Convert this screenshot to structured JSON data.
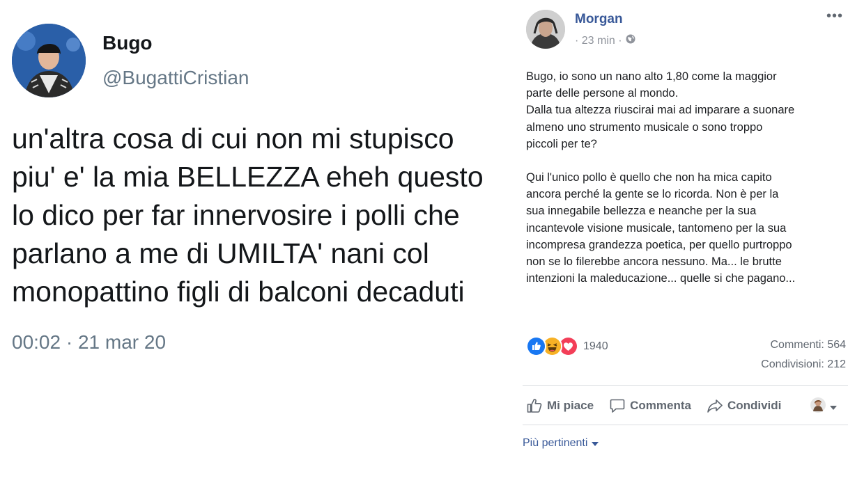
{
  "tweet": {
    "name": "Bugo",
    "handle": "@BugattiCristian",
    "text_lines": [
      "un'altra cosa di cui non mi stupisco",
      "piu' e' la mia BELLEZZA eheh questo",
      "lo dico per far innervosire i polli che",
      "parlano a me di UMILTA' nani col",
      "monopattino figli di balconi decaduti"
    ],
    "timestamp": "00:02 · 21 mar 20"
  },
  "fb_post": {
    "author": "Morgan",
    "time": "· 23 min ·",
    "privacy_icon": "globe-icon",
    "more_label": "•••",
    "paragraph1": [
      "Bugo, io sono un nano alto 1,80 come la maggior",
      "parte delle persone al mondo.",
      "Dalla tua altezza riuscirai mai ad imparare a suonare",
      "almeno uno strumento musicale o sono troppo",
      "piccoli per te?"
    ],
    "paragraph2": [
      "Qui l'unico pollo è quello che non ha mica capito",
      "ancora perché la gente se lo ricorda. Non è per la",
      "sua innegabile bellezza e neanche per la sua",
      "incantevole visione musicale, tantomeno per la sua",
      "incompresa grandezza poetica, per quello purtroppo",
      "non se lo filerebbe ancora nessuno. Ma... le brutte",
      "intenzioni la maleducazione... quelle si che pagano..."
    ],
    "reactions": {
      "icons": [
        "like-icon",
        "haha-icon",
        "love-icon"
      ],
      "count": "1940"
    },
    "comments": "Commenti: 564",
    "shares": "Condivisioni: 212",
    "actions": {
      "like": "Mi piace",
      "comment": "Commenta",
      "share": "Condividi"
    },
    "sort_label": "Più pertinenti"
  },
  "colors": {
    "fb_blue": "#385898",
    "twitter_gray": "#657786",
    "like_blue": "#1877f2",
    "love_red": "#f33e58",
    "haha_yellow": "#f7b125"
  }
}
